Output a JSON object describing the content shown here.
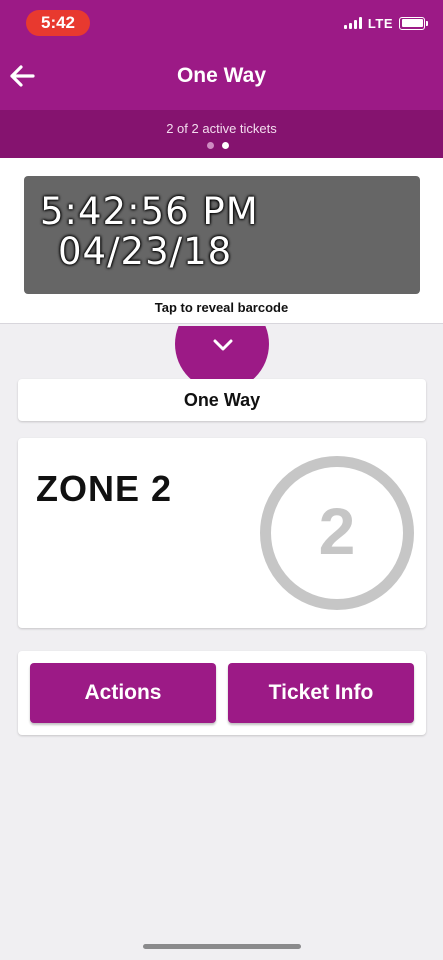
{
  "status_bar": {
    "time": "5:42",
    "network": "LTE",
    "signal_bars": 4
  },
  "header": {
    "title": "One Way",
    "back_icon": "arrow-left-icon",
    "ticket_count": "2 of 2 active tickets",
    "pager": {
      "total": 2,
      "active_index": 1
    }
  },
  "ticket": {
    "time": "5:42:56 PM",
    "date": "04/23/18",
    "reveal_label": "Tap to reveal barcode",
    "expand_icon": "chevron-down-icon",
    "fare_type": "One Way",
    "zone_label": "ZONE 2",
    "zone_number": "2"
  },
  "buttons": {
    "actions_label": "Actions",
    "ticket_info_label": "Ticket Info"
  },
  "colors": {
    "brand_purple": "#9c1a86",
    "brand_purple_dark": "#85136f",
    "status_red": "#e8392f",
    "clock_bg": "#666666",
    "zone_badge_gray": "#c6c6c6"
  }
}
